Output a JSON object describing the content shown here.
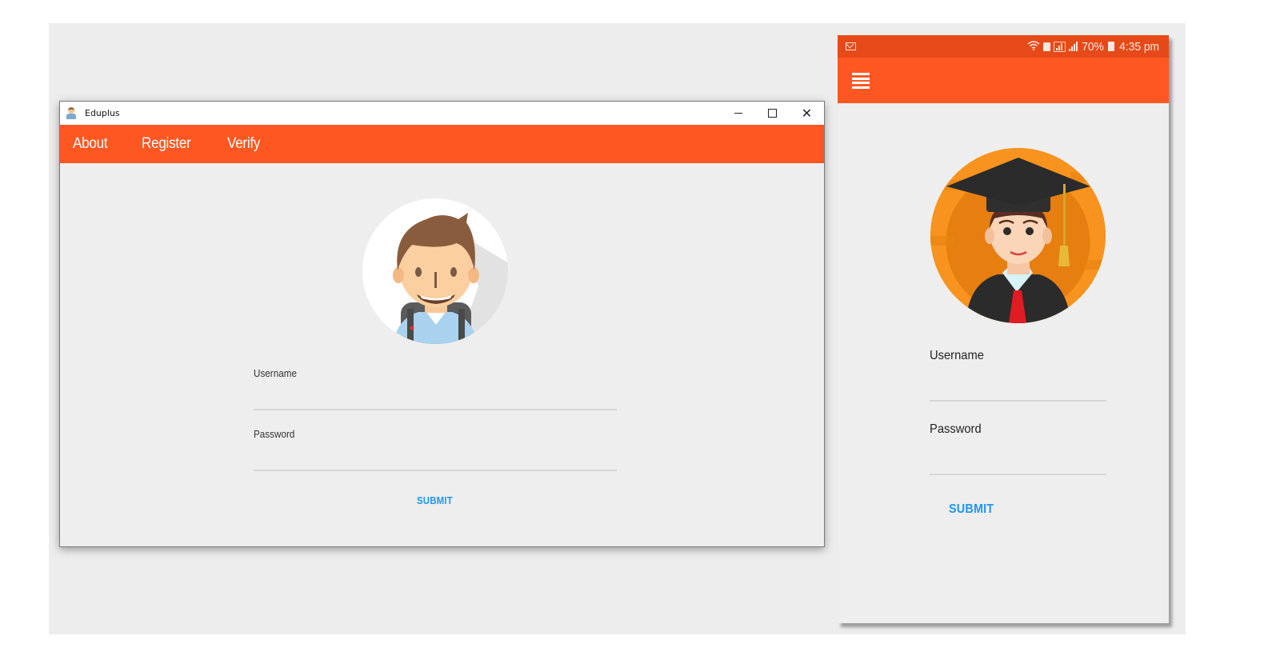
{
  "desktop": {
    "window_title": "Eduplus",
    "controls": {
      "minimize": "minimize-icon",
      "maximize": "maximize-icon",
      "close": "✕"
    },
    "nav": [
      {
        "label": "About"
      },
      {
        "label": "Register"
      },
      {
        "label": "Verify"
      }
    ],
    "form": {
      "username_label": "Username",
      "username_value": "",
      "password_label": "Password",
      "password_value": "",
      "submit_label": "SUBMIT"
    }
  },
  "mobile": {
    "status_bar": {
      "notification_icon": "mail-icon",
      "battery_percent": "70%",
      "time": "4:35 pm"
    },
    "menu_icon": "hamburger-menu-icon",
    "form": {
      "username_label": "Username",
      "username_value": "",
      "password_label": "Password",
      "password_value": "",
      "submit_label": "SUBMIT"
    }
  },
  "colors": {
    "primary": "#ff5722",
    "status_bar": "#e64a19",
    "accent": "#2196f3",
    "background": "#eeeeee"
  }
}
